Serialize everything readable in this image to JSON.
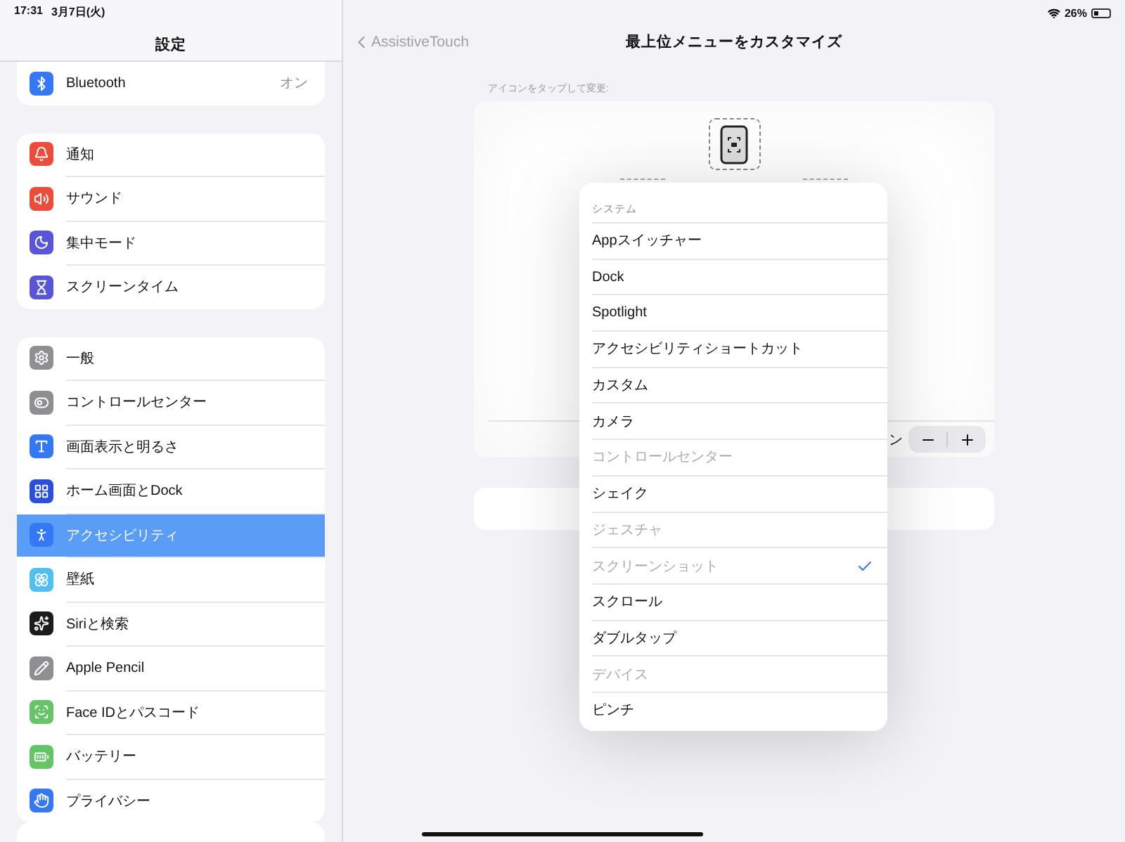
{
  "status_bar": {
    "time": "17:31",
    "date": "3月7日(火)",
    "battery": "26%"
  },
  "sidebar": {
    "title": "設定",
    "groups": [
      {
        "items": [
          {
            "label": "Bluetooth",
            "value": "オン",
            "color": "#3478f6",
            "selected": false
          }
        ]
      },
      {
        "items": [
          {
            "label": "通知",
            "color": "#eb4d3d",
            "selected": false
          },
          {
            "label": "サウンド",
            "color": "#eb4d3d",
            "selected": false
          },
          {
            "label": "集中モード",
            "color": "#5856d6",
            "selected": false
          },
          {
            "label": "スクリーンタイム",
            "color": "#5856d6",
            "selected": false
          }
        ]
      },
      {
        "items": [
          {
            "label": "一般",
            "color": "#8e8e93",
            "selected": false
          },
          {
            "label": "コントロールセンター",
            "color": "#8e8e93",
            "selected": false
          },
          {
            "label": "画面表示と明るさ",
            "color": "#3478f6",
            "selected": false
          },
          {
            "label": "ホーム画面とDock",
            "color": "#2b4fd6",
            "selected": false
          },
          {
            "label": "アクセシビリティ",
            "color": "#3478f6",
            "selected": true
          },
          {
            "label": "壁紙",
            "color": "#54bef0",
            "selected": false
          },
          {
            "label": "Siriと検索",
            "color": "#1c1c1e",
            "selected": false
          },
          {
            "label": "Apple Pencil",
            "color": "#8e8e93",
            "selected": false
          },
          {
            "label": "Face IDとパスコード",
            "color": "#65c466",
            "selected": false
          },
          {
            "label": "バッテリー",
            "color": "#65c466",
            "selected": false
          },
          {
            "label": "プライバシー",
            "color": "#3478f6",
            "selected": false
          }
        ]
      }
    ]
  },
  "detail": {
    "back": "AssistiveTouch",
    "title": "最上位メニューをカスタマイズ",
    "caption": "アイコンをタップして変更:",
    "count_label": "ン"
  },
  "popover": {
    "header": "システム",
    "items": [
      {
        "label": "Appスイッチャー",
        "disabled": false,
        "selected": false
      },
      {
        "label": "Dock",
        "disabled": false,
        "selected": false
      },
      {
        "label": "Spotlight",
        "disabled": false,
        "selected": false
      },
      {
        "label": "アクセシビリティショートカット",
        "disabled": false,
        "selected": false
      },
      {
        "label": "カスタム",
        "disabled": false,
        "selected": false
      },
      {
        "label": "カメラ",
        "disabled": false,
        "selected": false
      },
      {
        "label": "コントロールセンター",
        "disabled": true,
        "selected": false
      },
      {
        "label": "シェイク",
        "disabled": false,
        "selected": false
      },
      {
        "label": "ジェスチャ",
        "disabled": true,
        "selected": false
      },
      {
        "label": "スクリーンショット",
        "disabled": true,
        "selected": true
      },
      {
        "label": "スクロール",
        "disabled": false,
        "selected": false
      },
      {
        "label": "ダブルタップ",
        "disabled": false,
        "selected": false
      },
      {
        "label": "デバイス",
        "disabled": true,
        "selected": false
      },
      {
        "label": "ピンチ",
        "disabled": false,
        "selected": false
      }
    ]
  }
}
